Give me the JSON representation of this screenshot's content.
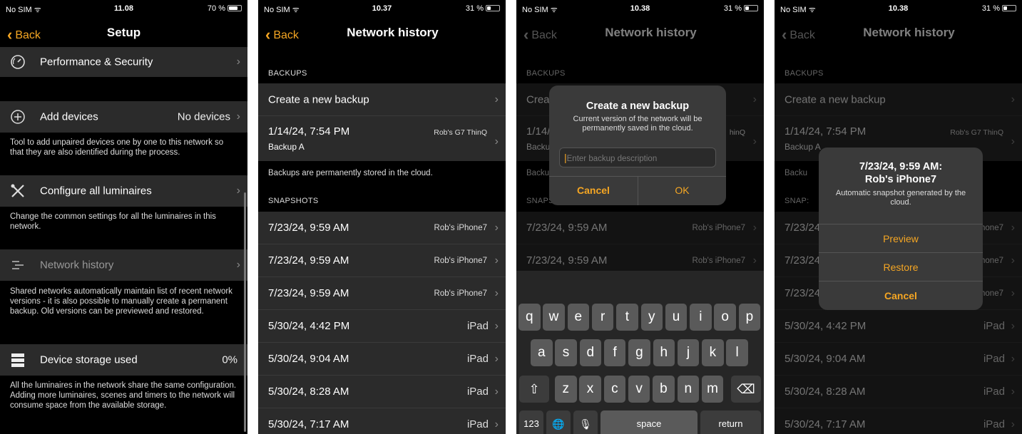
{
  "screens": [
    {
      "status": {
        "carrier": "No SIM",
        "time": "11.08",
        "battery": "70 %"
      },
      "nav": {
        "back": "Back",
        "title": "Setup"
      },
      "rows": {
        "performance": "Performance & Security",
        "add_devices": "Add devices",
        "add_devices_value": "No devices",
        "add_devices_note": "Tool to add unpaired devices one by one to this network so that they are also identified during the process.",
        "configure": "Configure all luminaires",
        "configure_note": "Change the common settings for all the luminaires in this network.",
        "network_history": "Network history",
        "network_history_note": "Shared networks automatically maintain list of recent network versions - it is also possible to manually create a permanent backup. Old versions can be previewed and restored.",
        "storage": "Device storage used",
        "storage_value": "0%",
        "storage_note": "All the luminaires in the network share the same configuration. Adding more luminaires, scenes and timers to the network will consume space from the available storage."
      }
    },
    {
      "status": {
        "carrier": "No SIM",
        "time": "10.37",
        "battery": "31 %"
      },
      "nav": {
        "back": "Back",
        "title": "Network history"
      },
      "backups_header": "BACKUPS",
      "create_backup": "Create a new backup",
      "backup": {
        "date": "1/14/24, 7:54 PM",
        "name": "Backup A",
        "device": "Rob's G7 ThinQ"
      },
      "backups_note": "Backups are permanently stored in the cloud.",
      "snapshots_header": "SNAPSHOTS",
      "snapshots": [
        {
          "date": "7/23/24, 9:59 AM",
          "device": "Rob's iPhone7"
        },
        {
          "date": "7/23/24, 9:59 AM",
          "device": "Rob's iPhone7"
        },
        {
          "date": "7/23/24, 9:59 AM",
          "device": "Rob's iPhone7"
        },
        {
          "date": "5/30/24, 4:42 PM",
          "device": "iPad"
        },
        {
          "date": "5/30/24, 9:04 AM",
          "device": "iPad"
        },
        {
          "date": "5/30/24, 8:28 AM",
          "device": "iPad"
        },
        {
          "date": "5/30/24, 7:17 AM",
          "device": "iPad"
        }
      ]
    },
    {
      "status": {
        "carrier": "No SIM",
        "time": "10.38",
        "battery": "31 %"
      },
      "nav": {
        "back": "Back",
        "title": "Network history"
      },
      "partial": {
        "create": "Crea",
        "backup_date": "1/14/",
        "backup_name": "Backu",
        "device": "hinQ",
        "note": "Backu",
        "snaps": "SNAPS"
      },
      "dialog": {
        "title": "Create a new backup",
        "message": "Current version of the network will be permanently saved in the cloud.",
        "placeholder": "Enter backup description",
        "cancel": "Cancel",
        "ok": "OK"
      },
      "keyboard": {
        "row1": [
          "q",
          "w",
          "e",
          "r",
          "t",
          "y",
          "u",
          "i",
          "o",
          "p"
        ],
        "row2": [
          "a",
          "s",
          "d",
          "f",
          "g",
          "h",
          "j",
          "k",
          "l"
        ],
        "row3": [
          "z",
          "x",
          "c",
          "v",
          "b",
          "n",
          "m"
        ],
        "shift": "⇧",
        "delete": "⌫",
        "numbers": "123",
        "globe": "🌐",
        "mic": "🎙",
        "space": "space",
        "return": "return"
      }
    },
    {
      "status": {
        "carrier": "No SIM",
        "time": "10.38",
        "battery": "31 %"
      },
      "nav": {
        "back": "Back",
        "title": "Network history"
      },
      "partial": {
        "snap_prefix": "7/23/",
        "device_suffix": "ne7",
        "note": "Backu",
        "snaps": "SNAP:"
      },
      "sheet": {
        "title": "7/23/24, 9:59 AM:",
        "subtitle": "Rob's iPhone7",
        "message": "Automatic snapshot generated by the cloud.",
        "preview": "Preview",
        "restore": "Restore",
        "cancel": "Cancel"
      }
    }
  ],
  "colors": {
    "accent": "#f5a623",
    "row_bg": "#2b2b2b",
    "background": "#000000"
  }
}
